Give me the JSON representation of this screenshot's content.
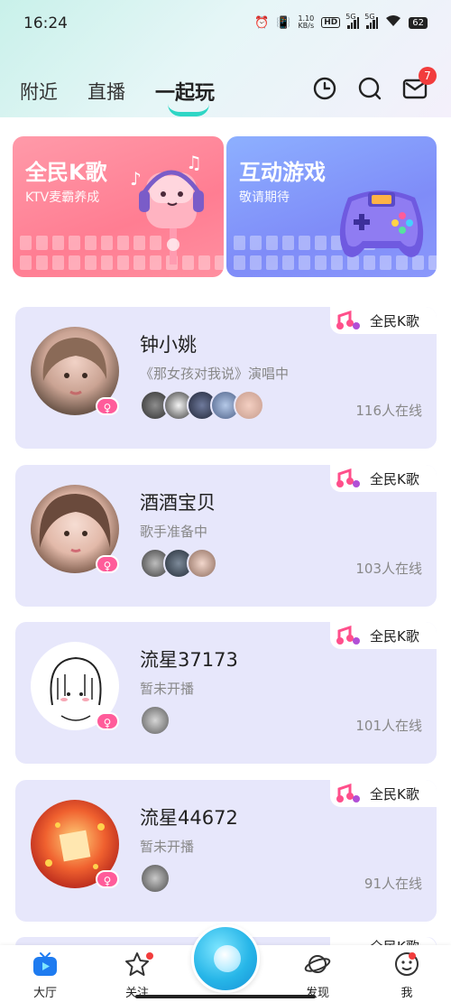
{
  "status_bar": {
    "time": "16:24",
    "net_speed_value": "1.10",
    "net_speed_unit": "KB/s",
    "hd_label": "HD",
    "sim1_label": "5G",
    "sim2_label": "5G",
    "battery": "62"
  },
  "header": {
    "tabs": [
      {
        "label": "附近"
      },
      {
        "label": "直播"
      },
      {
        "label": "一起玩"
      }
    ],
    "active_tab_index": 2,
    "mail_badge": "7",
    "accent_color": "#2ed6c5"
  },
  "banners": [
    {
      "title": "全民K歌",
      "subtitle": "KTV麦霸养成",
      "color": "#ff7d92"
    },
    {
      "title": "互动游戏",
      "subtitle": "敬请期待",
      "color": "#7f8cf8"
    }
  ],
  "cards": [
    {
      "name": "钟小姚",
      "status": "《那女孩对我说》演唱中",
      "online": "116人在线",
      "tag": "全民K歌"
    },
    {
      "name": "酒酒宝贝",
      "status": "歌手准备中",
      "online": "103人在线",
      "tag": "全民K歌"
    },
    {
      "name": "流星37173",
      "status": "暂未开播",
      "online": "101人在线",
      "tag": "全民K歌"
    },
    {
      "name": "流星44672",
      "status": "暂未开播",
      "online": "91人在线",
      "tag": "全民K歌"
    },
    {
      "tag": "全民K歌"
    }
  ],
  "bottom_nav": [
    {
      "label": "大厅"
    },
    {
      "label": "关注"
    },
    {
      "label": "发现"
    },
    {
      "label": "我"
    }
  ]
}
